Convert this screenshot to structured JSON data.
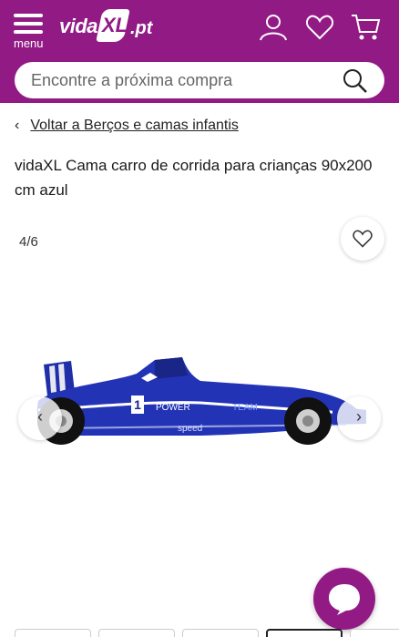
{
  "header": {
    "menu_label": "menu",
    "logo": {
      "prefix": "vida",
      "xl": "XL",
      "suffix": ".pt"
    },
    "icons": [
      "account-icon",
      "heart-icon",
      "cart-icon"
    ],
    "brand_color": "#921a85"
  },
  "search": {
    "placeholder": "Encontre a próxima compra"
  },
  "breadcrumb": {
    "back_label": "Voltar a Berços e camas infantis"
  },
  "product": {
    "title": "vidaXL Cama carro de corrida para crianças 90x200 cm azul",
    "image_counter": "4/6",
    "car_labels": {
      "number": "1",
      "power": "POWER",
      "team": "TEAM",
      "speed": "speed"
    }
  },
  "gallery": {
    "thumbnail_count": 5,
    "active_thumbnail": 4
  }
}
